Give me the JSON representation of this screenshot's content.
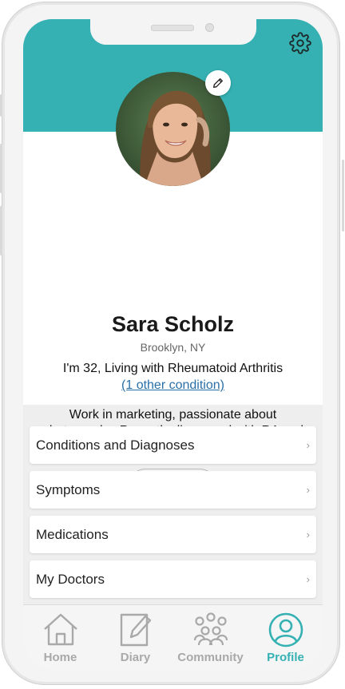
{
  "profile": {
    "name": "Sara Scholz",
    "location": "Brooklyn, NY",
    "condition_line": "I'm 32, Living with Rheumatoid Arthritis",
    "other_conditions": "(1 other condition)",
    "bio": "Work in marketing, passionate about photography. Recently diagnosed with RA and working on getting better.",
    "edit_label": "edit"
  },
  "menu": [
    {
      "label": "Conditions and Diagnoses"
    },
    {
      "label": "Symptoms"
    },
    {
      "label": "Medications"
    },
    {
      "label": "My Doctors"
    }
  ],
  "tabs": [
    {
      "label": "Home",
      "icon": "home-icon"
    },
    {
      "label": "Diary",
      "icon": "diary-icon"
    },
    {
      "label": "Community",
      "icon": "community-icon"
    },
    {
      "label": "Profile",
      "icon": "profile-icon",
      "active": true
    }
  ],
  "colors": {
    "accent": "#35b1b3",
    "link": "#2a6fa8",
    "inactive_tab": "#a9a9a9"
  }
}
